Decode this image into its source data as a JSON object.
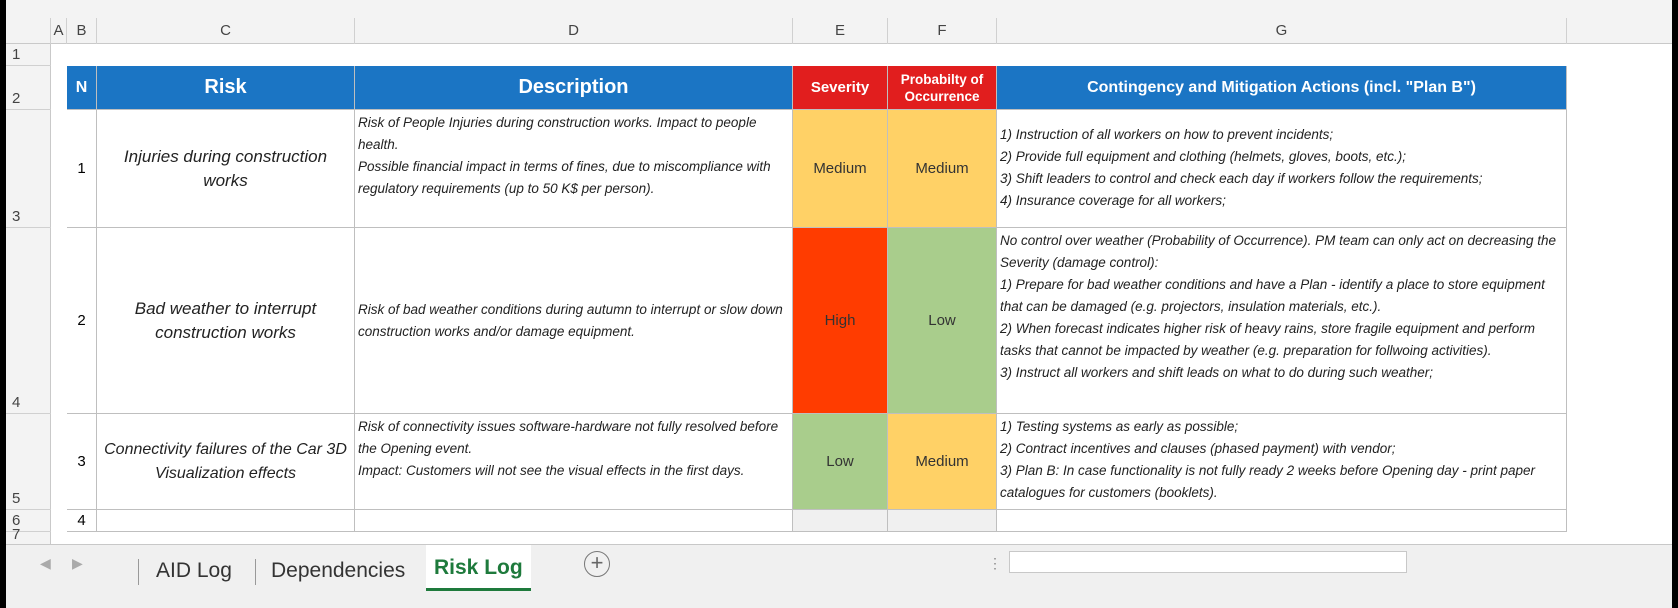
{
  "columns": [
    "A",
    "B",
    "C",
    "D",
    "E",
    "F",
    "G"
  ],
  "row_numbers": [
    "1",
    "2",
    "3",
    "4",
    "5",
    "6",
    "7"
  ],
  "table": {
    "headers": {
      "n": "N",
      "risk": "Risk",
      "description": "Description",
      "severity": "Severity",
      "probability_line1": "Probabilty of",
      "probability_line2": "Occurrence",
      "actions": "Contingency and Mitigation Actions (incl. \"Plan B\")"
    },
    "rows": [
      {
        "n": "1",
        "risk": "Injuries during construction works",
        "description": [
          "Risk of People Injuries during construction works. Impact to people health.",
          "Possible financial impact in terms of fines, due to miscompliance with regulatory requirements (up to 50 K$ per person)."
        ],
        "severity": "Medium",
        "probability": "Medium",
        "actions": [
          "1) Instruction of all workers on how to prevent incidents;",
          "2) Provide full equipment and clothing (helmets, gloves, boots, etc.);",
          "3) Shift leaders to control and check each day if workers follow the requirements;",
          "4) Insurance coverage for all workers;"
        ]
      },
      {
        "n": "2",
        "risk": "Bad weather to interrupt construction works",
        "description": [
          "Risk of bad weather conditions during autumn to interrupt or slow down construction works and/or damage equipment."
        ],
        "severity": "High",
        "probability": "Low",
        "actions": [
          "No control over weather (Probability of Occurrence). PM team can only act on decreasing the Severity (damage control):",
          "1) Prepare for bad weather conditions and have a Plan - identify a place to store equipment that can be damaged (e.g. projectors, insulation materials, etc.).",
          "2) When forecast indicates higher risk of heavy rains, store fragile equipment and perform tasks that cannot be impacted by weather (e.g. preparation for follwoing activities).",
          "3) Instruct all workers and shift leads on what to do during such weather;"
        ]
      },
      {
        "n": "3",
        "risk": "Connectivity failures of the Car 3D Visualization effects",
        "description": [
          "Risk of connectivity issues software-hardware not fully resolved before the Opening event.",
          "Impact: Customers will not see the visual effects in the first days."
        ],
        "severity": "Low",
        "probability": "Medium",
        "actions": [
          "1) Testing systems as early as possible;",
          "2) Contract incentives and clauses (phased payment) with vendor;",
          "3) Plan B: In case functionality is not fully ready 2 weeks before Opening day - print paper catalogues for customers (booklets)."
        ]
      },
      {
        "n": "4"
      }
    ]
  },
  "tabs": [
    "AID Log",
    "Dependencies",
    "Risk Log"
  ],
  "active_tab": "Risk Log",
  "add_sheet_symbol": "+",
  "colors": {
    "header_blue": "#1b75c4",
    "header_red": "#e11e1e",
    "medium": "#ffd166",
    "high": "#ff3c00",
    "low": "#a9cd8c"
  }
}
